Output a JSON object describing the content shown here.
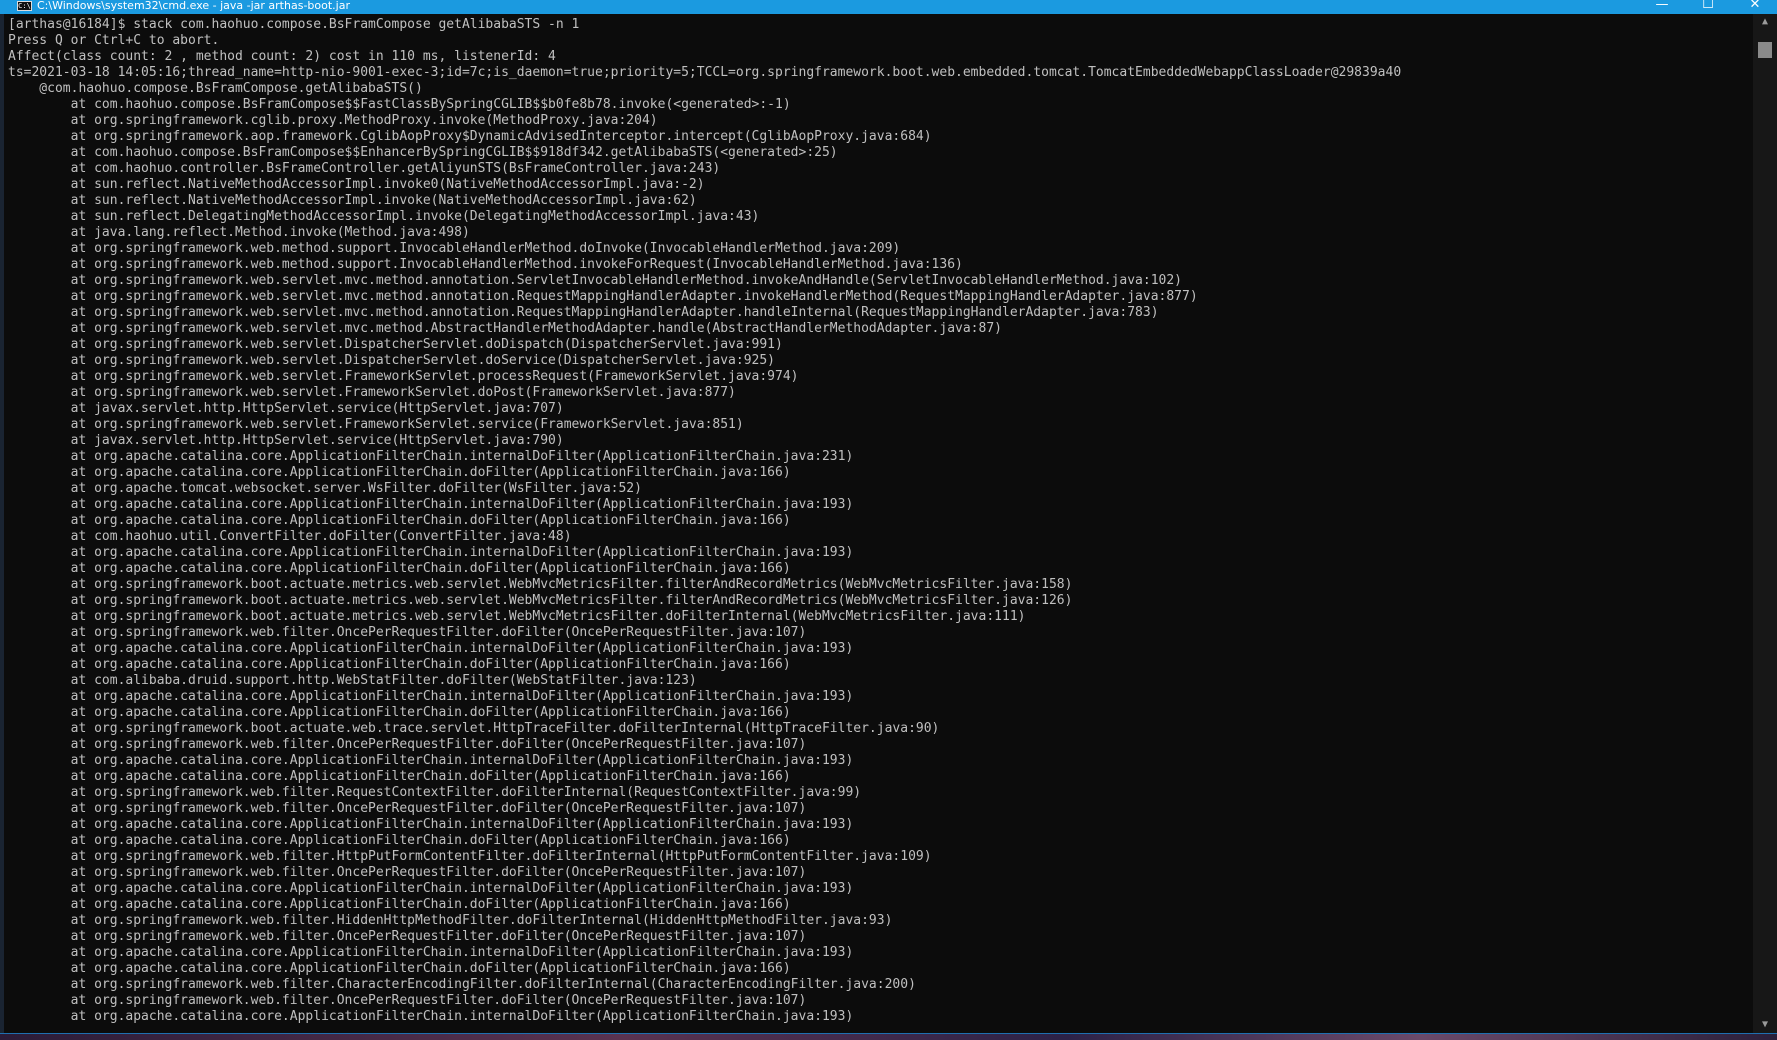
{
  "window": {
    "title": "C:\\Windows\\system32\\cmd.exe - java -jar arthas-boot.jar",
    "icon_label": "C:\\",
    "minimize_symbol": "—",
    "maximize_symbol": "☐",
    "close_symbol": "✕",
    "titlebar_color": "#1b9ae0",
    "console_bg": "#0c0c0c",
    "console_fg": "#c0c0c0"
  },
  "scrollbar": {
    "up_arrow": "▲",
    "down_arrow": "▼"
  },
  "console": {
    "lines": [
      "[arthas@16184]$ stack com.haohuo.compose.BsFramCompose getAlibabaSTS -n 1",
      "Press Q or Ctrl+C to abort.",
      "Affect(class count: 2 , method count: 2) cost in 110 ms, listenerId: 4",
      "ts=2021-03-18 14:05:16;thread_name=http-nio-9001-exec-3;id=7c;is_daemon=true;priority=5;TCCL=org.springframework.boot.web.embedded.tomcat.TomcatEmbeddedWebappClassLoader@29839a40",
      "    @com.haohuo.compose.BsFramCompose.getAlibabaSTS()",
      "        at com.haohuo.compose.BsFramCompose$$FastClassBySpringCGLIB$$b0fe8b78.invoke(<generated>:-1)",
      "        at org.springframework.cglib.proxy.MethodProxy.invoke(MethodProxy.java:204)",
      "        at org.springframework.aop.framework.CglibAopProxy$DynamicAdvisedInterceptor.intercept(CglibAopProxy.java:684)",
      "        at com.haohuo.compose.BsFramCompose$$EnhancerBySpringCGLIB$$918df342.getAlibabaSTS(<generated>:25)",
      "        at com.haohuo.controller.BsFrameController.getAliyunSTS(BsFrameController.java:243)",
      "        at sun.reflect.NativeMethodAccessorImpl.invoke0(NativeMethodAccessorImpl.java:-2)",
      "        at sun.reflect.NativeMethodAccessorImpl.invoke(NativeMethodAccessorImpl.java:62)",
      "        at sun.reflect.DelegatingMethodAccessorImpl.invoke(DelegatingMethodAccessorImpl.java:43)",
      "        at java.lang.reflect.Method.invoke(Method.java:498)",
      "        at org.springframework.web.method.support.InvocableHandlerMethod.doInvoke(InvocableHandlerMethod.java:209)",
      "        at org.springframework.web.method.support.InvocableHandlerMethod.invokeForRequest(InvocableHandlerMethod.java:136)",
      "        at org.springframework.web.servlet.mvc.method.annotation.ServletInvocableHandlerMethod.invokeAndHandle(ServletInvocableHandlerMethod.java:102)",
      "        at org.springframework.web.servlet.mvc.method.annotation.RequestMappingHandlerAdapter.invokeHandlerMethod(RequestMappingHandlerAdapter.java:877)",
      "        at org.springframework.web.servlet.mvc.method.annotation.RequestMappingHandlerAdapter.handleInternal(RequestMappingHandlerAdapter.java:783)",
      "        at org.springframework.web.servlet.mvc.method.AbstractHandlerMethodAdapter.handle(AbstractHandlerMethodAdapter.java:87)",
      "        at org.springframework.web.servlet.DispatcherServlet.doDispatch(DispatcherServlet.java:991)",
      "        at org.springframework.web.servlet.DispatcherServlet.doService(DispatcherServlet.java:925)",
      "        at org.springframework.web.servlet.FrameworkServlet.processRequest(FrameworkServlet.java:974)",
      "        at org.springframework.web.servlet.FrameworkServlet.doPost(FrameworkServlet.java:877)",
      "        at javax.servlet.http.HttpServlet.service(HttpServlet.java:707)",
      "        at org.springframework.web.servlet.FrameworkServlet.service(FrameworkServlet.java:851)",
      "        at javax.servlet.http.HttpServlet.service(HttpServlet.java:790)",
      "        at org.apache.catalina.core.ApplicationFilterChain.internalDoFilter(ApplicationFilterChain.java:231)",
      "        at org.apache.catalina.core.ApplicationFilterChain.doFilter(ApplicationFilterChain.java:166)",
      "        at org.apache.tomcat.websocket.server.WsFilter.doFilter(WsFilter.java:52)",
      "        at org.apache.catalina.core.ApplicationFilterChain.internalDoFilter(ApplicationFilterChain.java:193)",
      "        at org.apache.catalina.core.ApplicationFilterChain.doFilter(ApplicationFilterChain.java:166)",
      "        at com.haohuo.util.ConvertFilter.doFilter(ConvertFilter.java:48)",
      "        at org.apache.catalina.core.ApplicationFilterChain.internalDoFilter(ApplicationFilterChain.java:193)",
      "        at org.apache.catalina.core.ApplicationFilterChain.doFilter(ApplicationFilterChain.java:166)",
      "        at org.springframework.boot.actuate.metrics.web.servlet.WebMvcMetricsFilter.filterAndRecordMetrics(WebMvcMetricsFilter.java:158)",
      "        at org.springframework.boot.actuate.metrics.web.servlet.WebMvcMetricsFilter.filterAndRecordMetrics(WebMvcMetricsFilter.java:126)",
      "        at org.springframework.boot.actuate.metrics.web.servlet.WebMvcMetricsFilter.doFilterInternal(WebMvcMetricsFilter.java:111)",
      "        at org.springframework.web.filter.OncePerRequestFilter.doFilter(OncePerRequestFilter.java:107)",
      "        at org.apache.catalina.core.ApplicationFilterChain.internalDoFilter(ApplicationFilterChain.java:193)",
      "        at org.apache.catalina.core.ApplicationFilterChain.doFilter(ApplicationFilterChain.java:166)",
      "        at com.alibaba.druid.support.http.WebStatFilter.doFilter(WebStatFilter.java:123)",
      "        at org.apache.catalina.core.ApplicationFilterChain.internalDoFilter(ApplicationFilterChain.java:193)",
      "        at org.apache.catalina.core.ApplicationFilterChain.doFilter(ApplicationFilterChain.java:166)",
      "        at org.springframework.boot.actuate.web.trace.servlet.HttpTraceFilter.doFilterInternal(HttpTraceFilter.java:90)",
      "        at org.springframework.web.filter.OncePerRequestFilter.doFilter(OncePerRequestFilter.java:107)",
      "        at org.apache.catalina.core.ApplicationFilterChain.internalDoFilter(ApplicationFilterChain.java:193)",
      "        at org.apache.catalina.core.ApplicationFilterChain.doFilter(ApplicationFilterChain.java:166)",
      "        at org.springframework.web.filter.RequestContextFilter.doFilterInternal(RequestContextFilter.java:99)",
      "        at org.springframework.web.filter.OncePerRequestFilter.doFilter(OncePerRequestFilter.java:107)",
      "        at org.apache.catalina.core.ApplicationFilterChain.internalDoFilter(ApplicationFilterChain.java:193)",
      "        at org.apache.catalina.core.ApplicationFilterChain.doFilter(ApplicationFilterChain.java:166)",
      "        at org.springframework.web.filter.HttpPutFormContentFilter.doFilterInternal(HttpPutFormContentFilter.java:109)",
      "        at org.springframework.web.filter.OncePerRequestFilter.doFilter(OncePerRequestFilter.java:107)",
      "        at org.apache.catalina.core.ApplicationFilterChain.internalDoFilter(ApplicationFilterChain.java:193)",
      "        at org.apache.catalina.core.ApplicationFilterChain.doFilter(ApplicationFilterChain.java:166)",
      "        at org.springframework.web.filter.HiddenHttpMethodFilter.doFilterInternal(HiddenHttpMethodFilter.java:93)",
      "        at org.springframework.web.filter.OncePerRequestFilter.doFilter(OncePerRequestFilter.java:107)",
      "        at org.apache.catalina.core.ApplicationFilterChain.internalDoFilter(ApplicationFilterChain.java:193)",
      "        at org.apache.catalina.core.ApplicationFilterChain.doFilter(ApplicationFilterChain.java:166)",
      "        at org.springframework.web.filter.CharacterEncodingFilter.doFilterInternal(CharacterEncodingFilter.java:200)",
      "        at org.springframework.web.filter.OncePerRequestFilter.doFilter(OncePerRequestFilter.java:107)",
      "        at org.apache.catalina.core.ApplicationFilterChain.internalDoFilter(ApplicationFilterChain.java:193)"
    ]
  }
}
